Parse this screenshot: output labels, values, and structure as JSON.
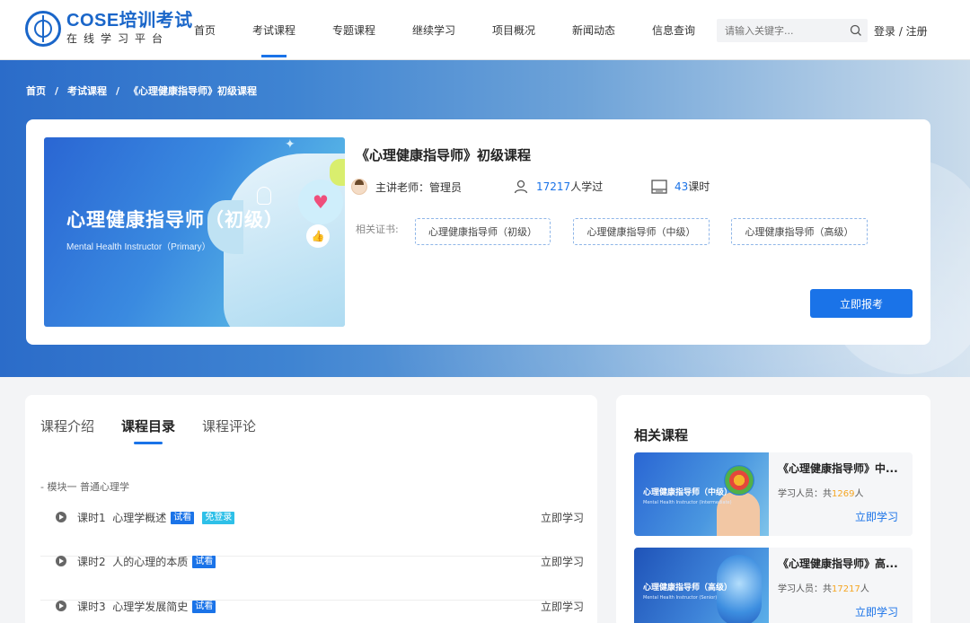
{
  "logo": {
    "title": "COSE培训考试",
    "subtitle": "在线学习平台"
  },
  "nav": {
    "items": [
      {
        "label": "首页"
      },
      {
        "label": "考试课程"
      },
      {
        "label": "专题课程"
      },
      {
        "label": "继续学习"
      },
      {
        "label": "项目概况"
      },
      {
        "label": "新闻动态"
      },
      {
        "label": "信息查询"
      }
    ],
    "active": "考试课程"
  },
  "search": {
    "placeholder": "请输入关键字..."
  },
  "auth": {
    "label": "登录 / 注册"
  },
  "breadcrumb": {
    "home": "首页",
    "sep": "/",
    "category": "考试课程",
    "current": "《心理健康指导师》初级课程"
  },
  "course": {
    "cover_title": "心理健康指导师（初级）",
    "cover_subtitle": "Mental Health Instructor（Primary）",
    "title": "《心理健康指导师》初级课程",
    "teacher": "主讲老师：管理员",
    "learners_num": "17217",
    "learners_suffix": "人学过",
    "hours_num": "43",
    "hours_suffix": "课时",
    "cert_label": "相关证书:",
    "certs": [
      "心理健康指导师（初级）",
      "心理健康指导师（中级）",
      "心理健康指导师（高级）"
    ],
    "enroll": "立即报考"
  },
  "tabs": [
    "课程介绍",
    "课程目录",
    "课程评论"
  ],
  "active_tab": "课程目录",
  "catalog": {
    "module": "模块一  普通心理学",
    "lessons": [
      {
        "no": "课时1",
        "title": "心理学概述",
        "tag": "试看",
        "free": "免登录",
        "action": "立即学习"
      },
      {
        "no": "课时2",
        "title": "人的心理的本质",
        "tag": "试看",
        "action": "立即学习"
      },
      {
        "no": "课时3",
        "title": "心理学发展简史",
        "tag": "试看",
        "action": "立即学习"
      }
    ]
  },
  "related": {
    "title": "相关课程",
    "items": [
      {
        "title": "《心理健康指导师》中...",
        "img_title": "心理健康指导师（中级）",
        "img_sub": "Mental Health Instructor (Intermediate)",
        "count_label": "学习人员：共",
        "count": "1269",
        "count_suffix": "人",
        "action": "立即学习"
      },
      {
        "title": "《心理健康指导师》高...",
        "img_title": "心理健康指导师（高级）",
        "img_sub": "Mental Health Instructor (Senior)",
        "count_label": "学习人员：共",
        "count": "17217",
        "count_suffix": "人",
        "action": "立即学习"
      }
    ]
  },
  "colors": {
    "accent": "#1a73e8",
    "brand": "#1a66c9",
    "highlight": "#f5a623"
  }
}
